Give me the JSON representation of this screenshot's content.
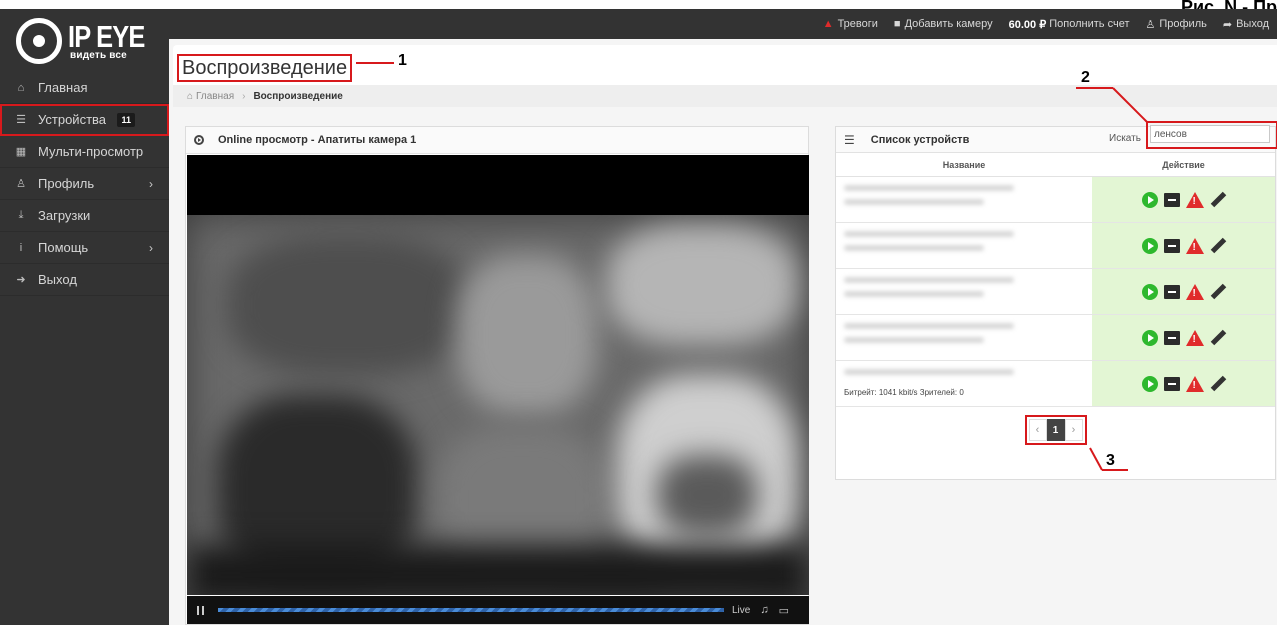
{
  "figure_caption": "Рис. N - Пр",
  "logo": {
    "brand": "IP EYE",
    "tagline": "видеть все"
  },
  "topbar": {
    "alarms": "Тревоги",
    "add_camera": "Добавить камеру",
    "balance": "60.00 ₽",
    "top_up": "Пополнить счет",
    "profile": "Профиль",
    "logout": "Выход"
  },
  "sidebar": {
    "items": [
      {
        "label": "Главная",
        "icon": "home-icon"
      },
      {
        "label": "Устройства",
        "icon": "list-icon",
        "badge": "11"
      },
      {
        "label": "Мульти-просмотр",
        "icon": "grid-icon"
      },
      {
        "label": "Профиль",
        "icon": "user-icon"
      },
      {
        "label": "Загрузки",
        "icon": "download-icon"
      },
      {
        "label": "Помощь",
        "icon": "info-icon"
      },
      {
        "label": "Выход",
        "icon": "logout-icon"
      }
    ]
  },
  "page": {
    "title": "Воспроизведение"
  },
  "breadcrumb": {
    "home": "Главная",
    "current": "Воспроизведение"
  },
  "video": {
    "title": "Online просмотр - Апатиты камера 1",
    "live_label": "Live"
  },
  "devices": {
    "title": "Список устройств",
    "search_label": "Искать",
    "search_value": "ленсов",
    "col_name": "Название",
    "col_action": "Действие",
    "last_row_info": "Битрейт: 1041 kbit/s   Зрителей: 0",
    "current_page": "1"
  },
  "callouts": {
    "one": "1",
    "two": "2",
    "three": "3"
  },
  "colors": {
    "highlight": "#d7191c",
    "action_bg": "#e3f6d4",
    "play": "#2eb82e",
    "warn": "#e02b2b"
  }
}
